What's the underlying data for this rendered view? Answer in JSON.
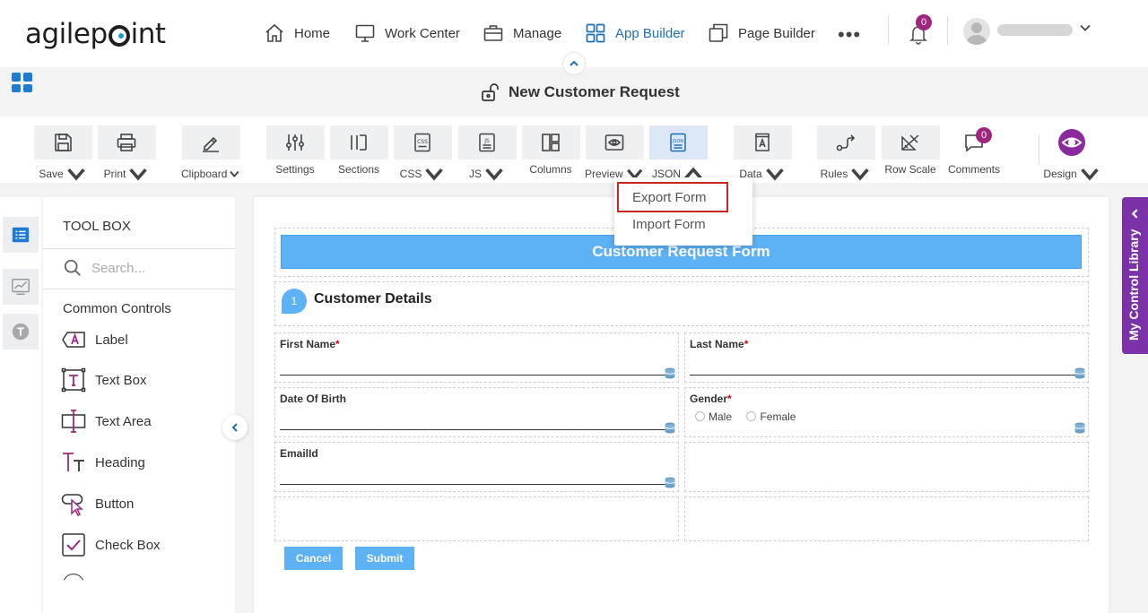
{
  "brand": {
    "logo_pre": "agilep",
    "logo_post": "int"
  },
  "nav": {
    "home": "Home",
    "work_center": "Work Center",
    "manage": "Manage",
    "app_builder": "App Builder",
    "page_builder": "Page Builder",
    "notification_count": "0"
  },
  "page": {
    "title": "New Customer Request"
  },
  "toolbar": {
    "save": "Save",
    "print": "Print",
    "clipboard": "Clipboard",
    "settings": "Settings",
    "sections": "Sections",
    "css": "CSS",
    "js": "JS",
    "columns": "Columns",
    "preview": "Preview",
    "json": "JSON",
    "data": "Data",
    "rules": "Rules",
    "row_scale": "Row Scale",
    "comments": "Comments",
    "comments_count": "0",
    "design": "Design"
  },
  "json_menu": {
    "export": "Export Form",
    "import": "Import Form"
  },
  "toolbox": {
    "title": "TOOL BOX",
    "search_placeholder": "Search...",
    "section": "Common Controls",
    "controls": [
      "Label",
      "Text Box",
      "Text Area",
      "Heading",
      "Button",
      "Check Box"
    ]
  },
  "form": {
    "header": "Customer Request Form",
    "step_number": "1",
    "section_title": "Customer Details",
    "first_name": "First Name",
    "last_name": "Last Name",
    "dob": "Date Of Birth",
    "gender": "Gender",
    "gender_male": "Male",
    "gender_female": "Female",
    "email": "EmailId",
    "required_mark": "*",
    "cancel": "Cancel",
    "submit": "Submit"
  },
  "control_library": {
    "label": "My Control Library"
  },
  "colors": {
    "accent_blue": "#1e6fb7",
    "form_blue": "#5db1f5",
    "purple": "#7b31a8",
    "badge": "#a0257f",
    "highlight_red": "#cc2525"
  }
}
